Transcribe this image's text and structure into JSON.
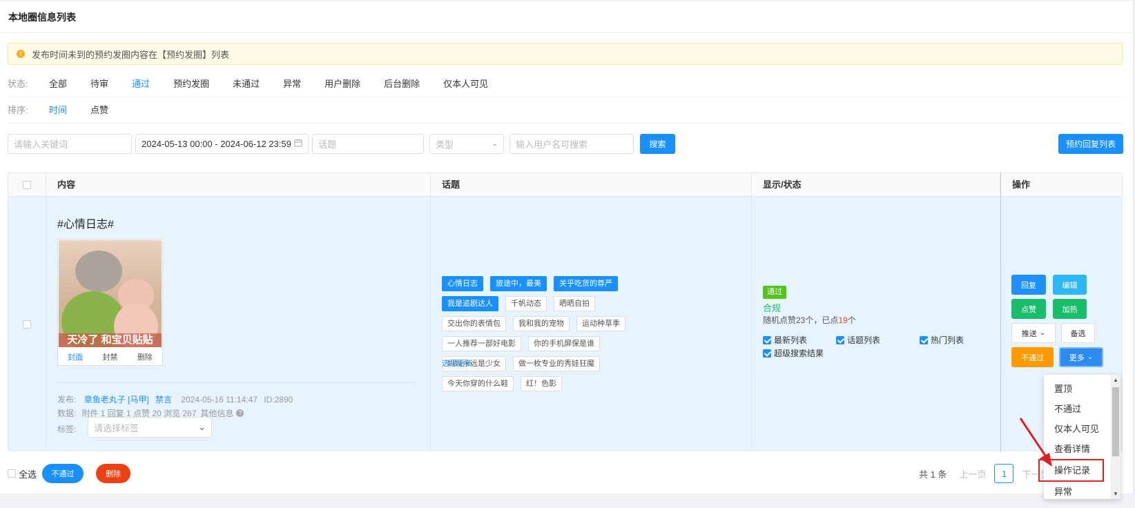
{
  "page": {
    "title": "本地圈信息列表"
  },
  "notice": {
    "text": "发布时间未到的预约发圈内容在【预约发圈】列表"
  },
  "status_filter": {
    "label": "状态:",
    "options": [
      "全部",
      "待审",
      "通过",
      "预约发圈",
      "未通过",
      "异常",
      "用户删除",
      "后台删除",
      "仅本人可见"
    ],
    "selected": "通过"
  },
  "sort_filter": {
    "label": "排序:",
    "options": [
      "时间",
      "点赞"
    ],
    "selected": "时间"
  },
  "search": {
    "keyword_placeholder": "请输入关键词",
    "date_range": "2024-05-13 00:00 - 2024-06-12 23:59",
    "topic_placeholder": "话题",
    "type_placeholder": "类型",
    "user_placeholder": "输入用户名可搜索",
    "search_button": "搜索",
    "schedule_button": "预约回复列表"
  },
  "table": {
    "headers": [
      "内容",
      "话题",
      "显示/状态",
      "操作"
    ],
    "row": {
      "title": "#心情日志#",
      "image_caption": "天冷了 和宝贝贴贴",
      "image_actions": [
        "封面",
        "封禁",
        "删除"
      ],
      "publish_label": "发布:",
      "author": "章鱼老丸子 [马甲]",
      "ban_link": "禁言",
      "datetime": "2024-05-16 11:14:47",
      "id_text": "ID:2890",
      "data_label": "数据:",
      "data_text": "附件 1 回复 1 点赞 20 浏览 267",
      "other_info": "其他信息",
      "tag_label": "标签:",
      "tag_placeholder": "请选择标签",
      "topics": [
        {
          "label": "心情日志",
          "selected": true
        },
        {
          "label": "旅途中，最美",
          "selected": true
        },
        {
          "label": "关乎吃货的尊严",
          "selected": true
        },
        {
          "label": "我是追剧达人",
          "selected": true
        },
        {
          "label": "千帆动态",
          "selected": false
        },
        {
          "label": "晒晒自拍",
          "selected": false
        },
        {
          "label": "交出你的表情包",
          "selected": false
        },
        {
          "label": "我和我的宠物",
          "selected": false
        },
        {
          "label": "运动种草季",
          "selected": false
        },
        {
          "label": "一人推荐一部好电影",
          "selected": false
        },
        {
          "label": "你的手机屏保是谁",
          "selected": false
        },
        {
          "label": "妈妈永远是少女",
          "selected": false
        },
        {
          "label": "做一枚专业的秀娃狂魔",
          "selected": false
        },
        {
          "label": "今天你穿的什么鞋",
          "selected": false
        },
        {
          "label": "红！色影",
          "selected": false
        }
      ],
      "more_topics": "选择更多",
      "status_badge": "通过",
      "compliance": "合规",
      "likes_text_prefix": "随机点赞23个，已点",
      "likes_done": "19",
      "likes_text_suffix": "个",
      "display_options": [
        {
          "label": "最新列表",
          "checked": true
        },
        {
          "label": "话题列表",
          "checked": true
        },
        {
          "label": "热门列表",
          "checked": true
        },
        {
          "label": "超级搜索结果",
          "checked": true
        }
      ],
      "actions": {
        "reply": "回复",
        "edit": "编辑",
        "like": "点赞",
        "boost": "加热",
        "push": "推送",
        "backup": "备选",
        "reject": "不通过",
        "more": "更多"
      }
    }
  },
  "more_menu": [
    "置顶",
    "不通过",
    "仅本人可见",
    "查看详情",
    "操作记录",
    "异常"
  ],
  "footer": {
    "select_all": "全选",
    "reject_button": "不通过",
    "delete_button": "删除",
    "total": "共 1 条",
    "prev": "上一页",
    "page": "1",
    "next": "下一页"
  },
  "colors": {
    "primary": "#1890ff",
    "success": "#19be6b",
    "warning": "#ff9900",
    "danger": "#ed4014",
    "highlight": "#ff3b30"
  }
}
